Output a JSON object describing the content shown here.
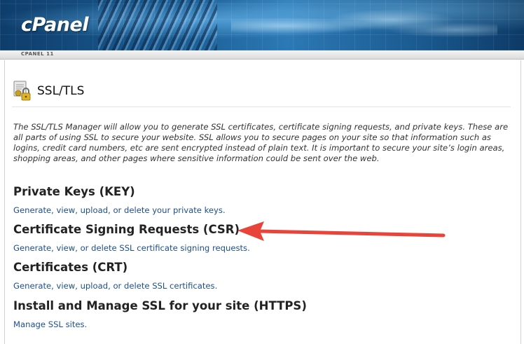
{
  "header": {
    "logo": "cPanel",
    "version": "CPANEL 11"
  },
  "page": {
    "title": "SSL/TLS",
    "intro": "The SSL/TLS Manager will allow you to generate SSL certificates, certificate signing requests, and private keys. These are all parts of using SSL to secure your website. SSL allows you to secure pages on your site so that information such as logins, credit card numbers, etc are sent encrypted instead of plain text. It is important to secure your site’s login areas, shopping areas, and other pages where sensitive information could be sent over the web."
  },
  "sections": [
    {
      "title": "Private Keys (KEY)",
      "link": "Generate, view, upload, or delete your private keys."
    },
    {
      "title": "Certificate Signing Requests (CSR)",
      "link": "Generate, view, or delete SSL certificate signing requests."
    },
    {
      "title": "Certificates (CRT)",
      "link": "Generate, view, upload, or delete SSL certificates."
    },
    {
      "title": "Install and Manage SSL for your site (HTTPS)",
      "link": "Manage SSL sites."
    }
  ],
  "annotation": {
    "arrow_color": "#e8443a"
  },
  "icons": {
    "page": "ssl-certificate-lock-icon",
    "annotation": "red-arrow-icon"
  }
}
